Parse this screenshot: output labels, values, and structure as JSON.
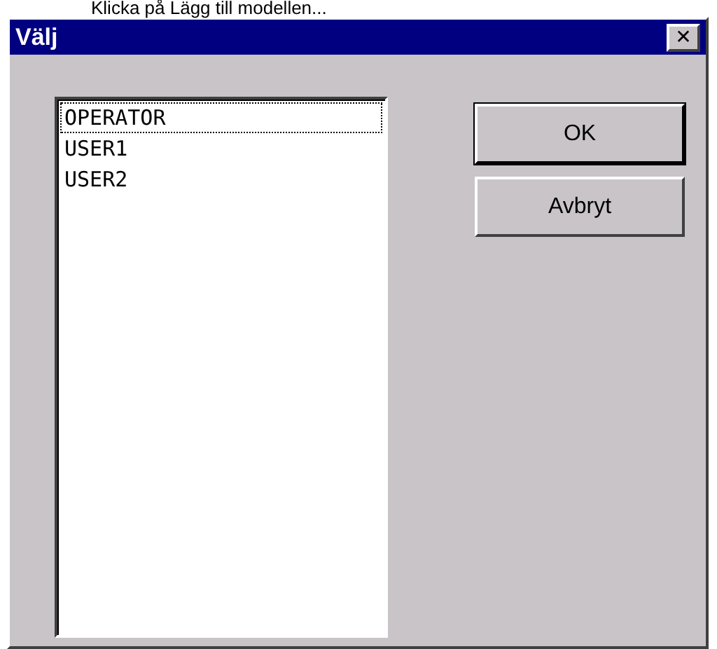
{
  "caption": "Klicka på Lägg till modellen...",
  "window": {
    "title": "Välj",
    "close": "✕"
  },
  "list": {
    "items": [
      {
        "label": "OPERATOR",
        "focused": true
      },
      {
        "label": "USER1",
        "focused": false
      },
      {
        "label": "USER2",
        "focused": false
      }
    ]
  },
  "buttons": [
    {
      "label": "OK",
      "default": true
    },
    {
      "label": "Avbryt",
      "default": false
    }
  ]
}
